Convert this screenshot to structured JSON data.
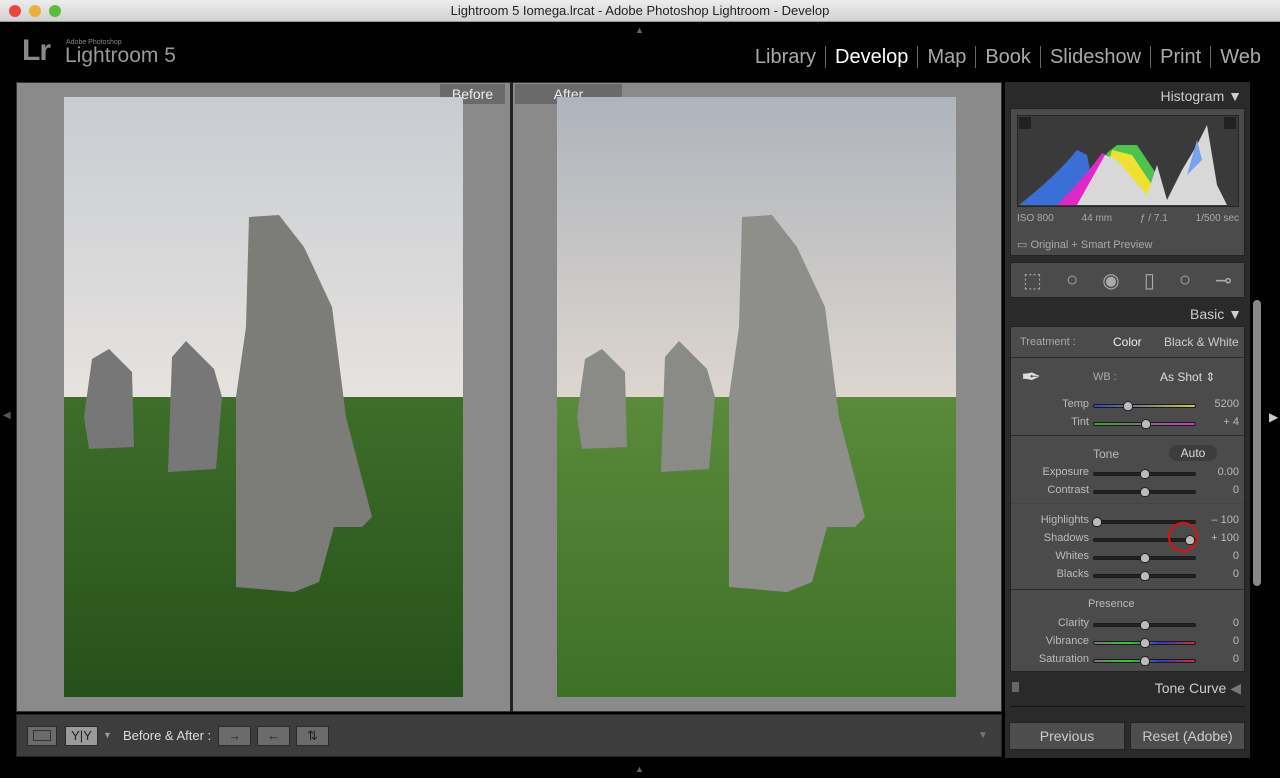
{
  "window": {
    "title": "Lightroom 5 Iomega.lrcat - Adobe Photoshop Lightroom - Develop"
  },
  "brand": {
    "logo": "Lr",
    "vendor": "Adobe Photoshop",
    "product": "Lightroom 5"
  },
  "modules": [
    {
      "label": "Library"
    },
    {
      "label": "Develop",
      "active": true
    },
    {
      "label": "Map"
    },
    {
      "label": "Book"
    },
    {
      "label": "Slideshow"
    },
    {
      "label": "Print"
    },
    {
      "label": "Web"
    }
  ],
  "view": {
    "before_label": "Before",
    "after_label": "After"
  },
  "toolbar": {
    "before_after_label": "Before & After :",
    "view_icon": "loupe-icon",
    "yy_label": "Y|Y"
  },
  "histogram": {
    "title": "Histogram",
    "iso": "ISO 800",
    "focal": "44 mm",
    "aperture": "ƒ / 7.1",
    "shutter": "1/500 sec",
    "preview": "Original + Smart Preview"
  },
  "basic": {
    "title": "Basic",
    "treatment_label": "Treatment :",
    "treatment_color": "Color",
    "treatment_bw": "Black & White",
    "wb_label": "WB :",
    "wb_value": "As Shot",
    "tone_label": "Tone",
    "auto_label": "Auto",
    "presence_label": "Presence",
    "sliders": [
      {
        "label": "Temp",
        "value": "5200",
        "level": 0.34
      },
      {
        "label": "Tint",
        "value": "+ 4",
        "level": 0.51
      },
      {
        "label": "Exposure",
        "value": "0.00",
        "level": 0.5
      },
      {
        "label": "Contrast",
        "value": "0",
        "level": 0.5
      },
      {
        "label": "Highlights",
        "value": "– 100",
        "level": 0.03
      },
      {
        "label": "Shadows",
        "value": "+ 100",
        "level": 0.95
      },
      {
        "label": "Whites",
        "value": "0",
        "level": 0.5
      },
      {
        "label": "Blacks",
        "value": "0",
        "level": 0.5
      },
      {
        "label": "Clarity",
        "value": "0",
        "level": 0.5
      },
      {
        "label": "Vibrance",
        "value": "0",
        "level": 0.5
      },
      {
        "label": "Saturation",
        "value": "0",
        "level": 0.5
      }
    ]
  },
  "tone_curve": {
    "title": "Tone Curve"
  },
  "buttons": {
    "previous": "Previous",
    "reset": "Reset (Adobe)"
  },
  "colors": {
    "highlight_circle": "#e01010",
    "panel": "#4b4b4b"
  }
}
